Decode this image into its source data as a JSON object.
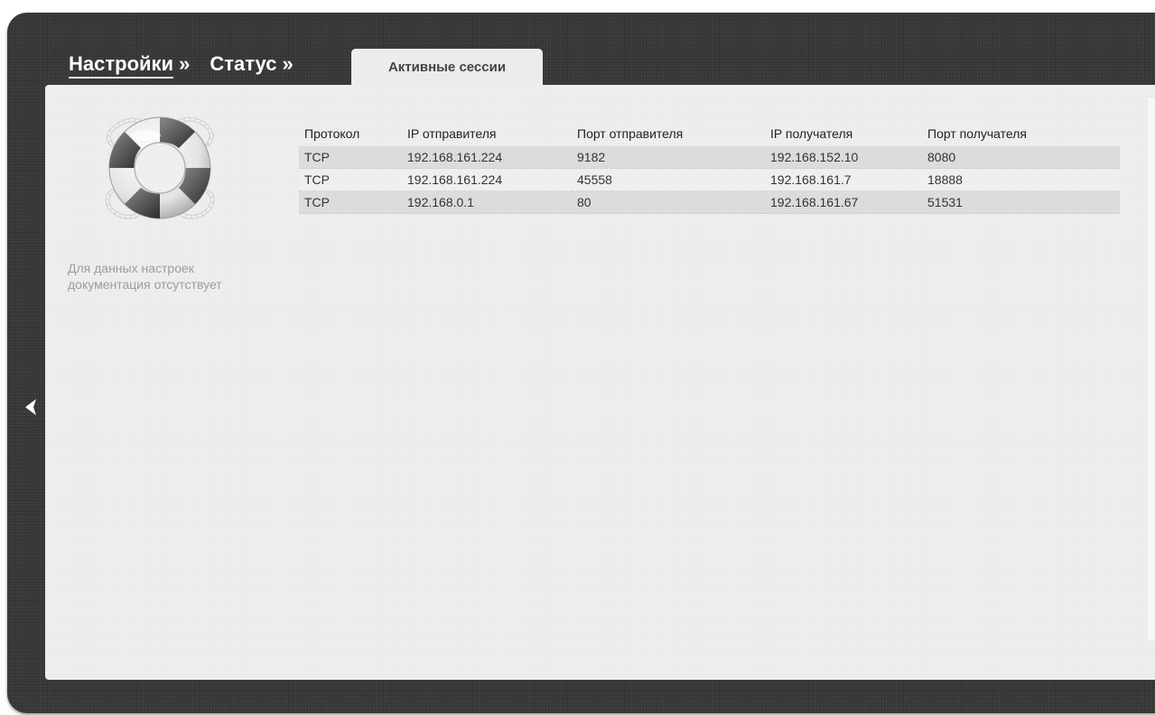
{
  "breadcrumb": {
    "settings": "Настройки",
    "sep1": "»",
    "status": "Статус",
    "sep2": "»"
  },
  "tab": {
    "label": "Активные сессии"
  },
  "help": {
    "icon": "lifebuoy-icon",
    "text": "Для данных настроек документация отсутствует"
  },
  "table": {
    "headers": [
      "Протокол",
      "IP отправителя",
      "Порт отправителя",
      "IP получателя",
      "Порт получателя"
    ],
    "rows": [
      [
        "TCP",
        "192.168.161.224",
        "9182",
        "192.168.152.10",
        "8080"
      ],
      [
        "TCP",
        "192.168.161.224",
        "45558",
        "192.168.161.7",
        "18888"
      ],
      [
        "TCP",
        "192.168.0.1",
        "80",
        "192.168.161.67",
        "51531"
      ]
    ]
  },
  "nav": {
    "back_icon": "chevron-left-icon"
  },
  "colors": {
    "frame": "#3b3b3b",
    "panel": "#efefef",
    "row_alt": "#dcdcdc",
    "help_text": "#9c9c9c"
  }
}
